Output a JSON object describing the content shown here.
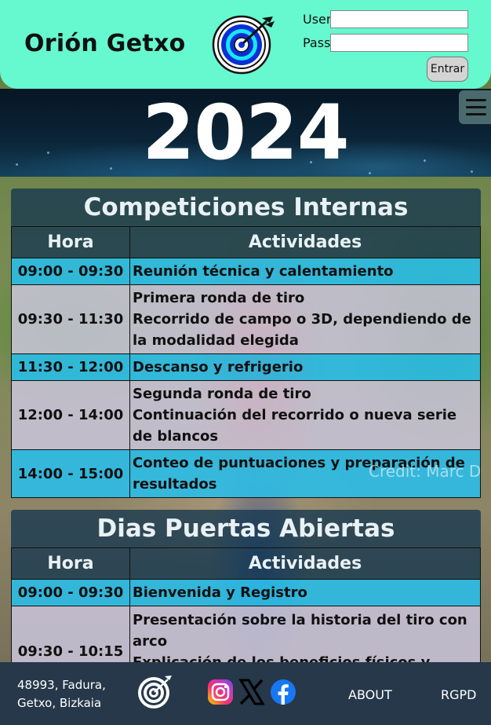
{
  "header": {
    "brand": "Orión Getxo",
    "login": {
      "user_label": "User",
      "pass_label": "Pass",
      "user_value": "",
      "pass_value": "",
      "submit_label": "Entrar"
    }
  },
  "banner": {
    "year": "2024"
  },
  "photo_credit": "Credit: Marc D",
  "sections": [
    {
      "title": "Competiciones Internas",
      "columns": [
        "Hora",
        "Actividades"
      ],
      "rows": [
        {
          "hora": "09:00 - 09:30",
          "lines": [
            "Reunión técnica y calentamiento"
          ],
          "style": "blue"
        },
        {
          "hora": "09:30 - 11:30",
          "lines": [
            "Primera ronda de tiro",
            "Recorrido de campo o 3D, dependiendo de la modalidad elegida"
          ],
          "style": "grey"
        },
        {
          "hora": "11:30 - 12:00",
          "lines": [
            "Descanso y refrigerio"
          ],
          "style": "blue"
        },
        {
          "hora": "12:00 - 14:00",
          "lines": [
            "Segunda ronda de tiro",
            "Continuación del recorrido o nueva serie de blancos"
          ],
          "style": "grey"
        },
        {
          "hora": "14:00 - 15:00",
          "lines": [
            "Conteo de puntuaciones y preparación de resultados"
          ],
          "style": "blue"
        }
      ]
    },
    {
      "title": "Dias Puertas Abiertas",
      "columns": [
        "Hora",
        "Actividades"
      ],
      "rows": [
        {
          "hora": "09:00 - 09:30",
          "lines": [
            "Bienvenida y Registro"
          ],
          "style": "blue"
        },
        {
          "hora": "09:30 - 10:15",
          "lines": [
            "Presentación sobre la historia del tiro con arco",
            "Explicación de los beneficios físicos y"
          ],
          "style": "grey"
        }
      ]
    }
  ],
  "footer": {
    "address_line1": "48993, Fadura,",
    "address_line2": "Getxo, Bizkaia",
    "social": [
      "instagram-icon",
      "x-icon",
      "facebook-icon"
    ],
    "about_label": "ABOUT",
    "rgpd_label": "RGPD"
  },
  "colors": {
    "header_bg": "#66f8cf",
    "footer_bg": "#26384a",
    "row_blue": "#28beeb",
    "row_grey": "#cdc8e1",
    "section_head": "#143750"
  }
}
